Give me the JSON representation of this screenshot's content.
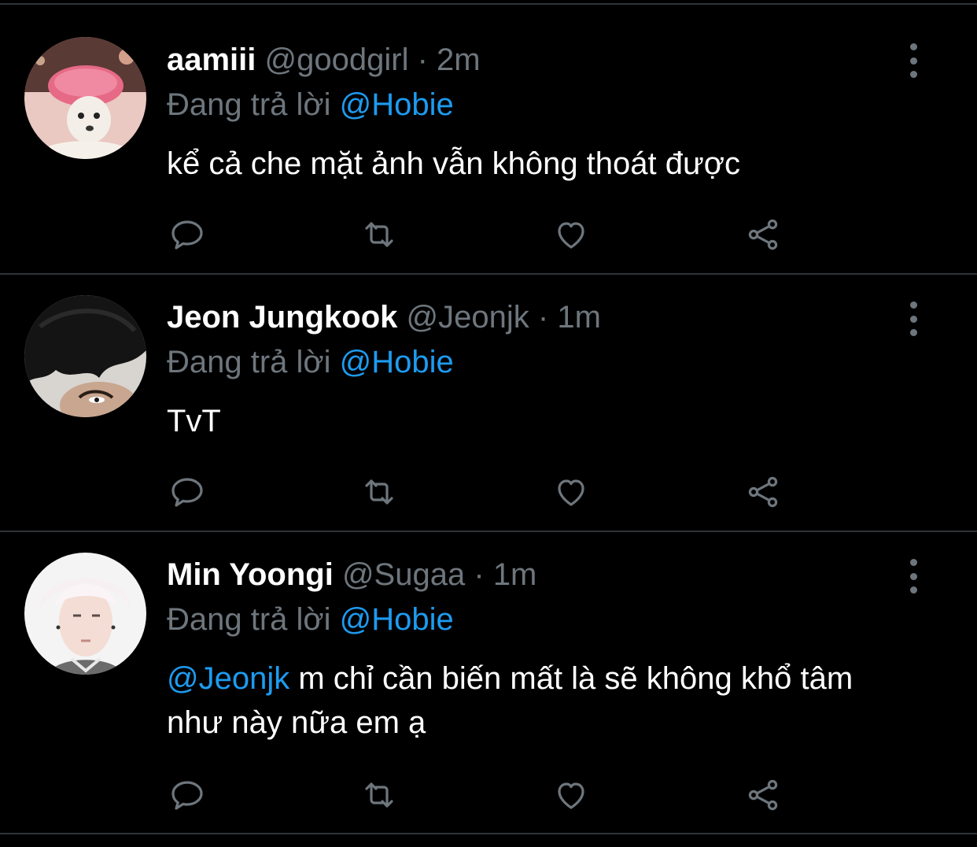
{
  "tweets": [
    {
      "name": "aamiii",
      "handle": "@goodgirl",
      "separator": "·",
      "time": "2m",
      "reply_prefix": "Đang trả lời",
      "reply_to": "@Hobie",
      "text_mention": "",
      "text": "kể cả che mặt ảnh vẫn không thoát được",
      "avatar": "chihuahua-with-pink-shower-cap"
    },
    {
      "name": "Jeon Jungkook",
      "handle": "@Jeonjk",
      "separator": "·",
      "time": "1m",
      "reply_prefix": "Đang trả lời",
      "reply_to": "@Hobie",
      "text_mention": "",
      "text": "TvT",
      "avatar": "dark-hair-peeking"
    },
    {
      "name": "Min Yoongi",
      "handle": "@Sugaa",
      "separator": "·",
      "time": "1m",
      "reply_prefix": "Đang trả lời",
      "reply_to": "@Hobie",
      "text_mention": "@Jeonjk",
      "text": " m chỉ cần biến mất là sẽ không khổ tâm như này nữa em ạ",
      "avatar": "white-hair-portrait"
    }
  ],
  "icons": {
    "reply": "reply-icon",
    "retweet": "retweet-icon",
    "like": "heart-icon",
    "share": "share-icon",
    "more": "more-vertical-icon"
  },
  "colors": {
    "background": "#000000",
    "name": "#ffffff",
    "muted": "#6e767d",
    "mention": "#1d9bf0",
    "divider": "#2f3336"
  }
}
